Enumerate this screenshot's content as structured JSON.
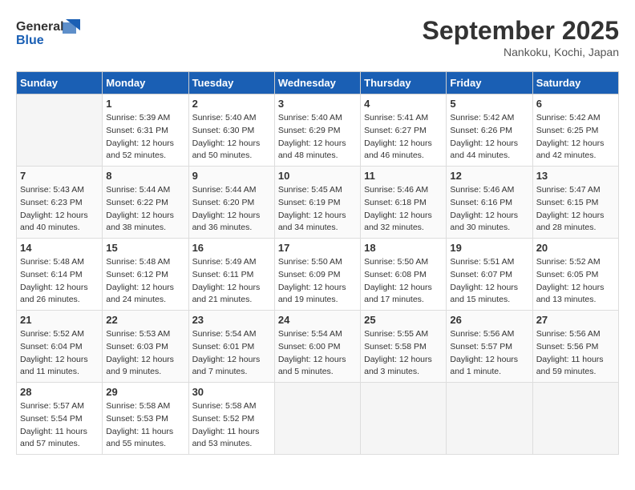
{
  "header": {
    "logo_line1": "General",
    "logo_line2": "Blue",
    "month": "September 2025",
    "location": "Nankoku, Kochi, Japan"
  },
  "weekdays": [
    "Sunday",
    "Monday",
    "Tuesday",
    "Wednesday",
    "Thursday",
    "Friday",
    "Saturday"
  ],
  "weeks": [
    [
      {
        "day": "",
        "info": ""
      },
      {
        "day": "1",
        "info": "Sunrise: 5:39 AM\nSunset: 6:31 PM\nDaylight: 12 hours\nand 52 minutes."
      },
      {
        "day": "2",
        "info": "Sunrise: 5:40 AM\nSunset: 6:30 PM\nDaylight: 12 hours\nand 50 minutes."
      },
      {
        "day": "3",
        "info": "Sunrise: 5:40 AM\nSunset: 6:29 PM\nDaylight: 12 hours\nand 48 minutes."
      },
      {
        "day": "4",
        "info": "Sunrise: 5:41 AM\nSunset: 6:27 PM\nDaylight: 12 hours\nand 46 minutes."
      },
      {
        "day": "5",
        "info": "Sunrise: 5:42 AM\nSunset: 6:26 PM\nDaylight: 12 hours\nand 44 minutes."
      },
      {
        "day": "6",
        "info": "Sunrise: 5:42 AM\nSunset: 6:25 PM\nDaylight: 12 hours\nand 42 minutes."
      }
    ],
    [
      {
        "day": "7",
        "info": "Sunrise: 5:43 AM\nSunset: 6:23 PM\nDaylight: 12 hours\nand 40 minutes."
      },
      {
        "day": "8",
        "info": "Sunrise: 5:44 AM\nSunset: 6:22 PM\nDaylight: 12 hours\nand 38 minutes."
      },
      {
        "day": "9",
        "info": "Sunrise: 5:44 AM\nSunset: 6:20 PM\nDaylight: 12 hours\nand 36 minutes."
      },
      {
        "day": "10",
        "info": "Sunrise: 5:45 AM\nSunset: 6:19 PM\nDaylight: 12 hours\nand 34 minutes."
      },
      {
        "day": "11",
        "info": "Sunrise: 5:46 AM\nSunset: 6:18 PM\nDaylight: 12 hours\nand 32 minutes."
      },
      {
        "day": "12",
        "info": "Sunrise: 5:46 AM\nSunset: 6:16 PM\nDaylight: 12 hours\nand 30 minutes."
      },
      {
        "day": "13",
        "info": "Sunrise: 5:47 AM\nSunset: 6:15 PM\nDaylight: 12 hours\nand 28 minutes."
      }
    ],
    [
      {
        "day": "14",
        "info": "Sunrise: 5:48 AM\nSunset: 6:14 PM\nDaylight: 12 hours\nand 26 minutes."
      },
      {
        "day": "15",
        "info": "Sunrise: 5:48 AM\nSunset: 6:12 PM\nDaylight: 12 hours\nand 24 minutes."
      },
      {
        "day": "16",
        "info": "Sunrise: 5:49 AM\nSunset: 6:11 PM\nDaylight: 12 hours\nand 21 minutes."
      },
      {
        "day": "17",
        "info": "Sunrise: 5:50 AM\nSunset: 6:09 PM\nDaylight: 12 hours\nand 19 minutes."
      },
      {
        "day": "18",
        "info": "Sunrise: 5:50 AM\nSunset: 6:08 PM\nDaylight: 12 hours\nand 17 minutes."
      },
      {
        "day": "19",
        "info": "Sunrise: 5:51 AM\nSunset: 6:07 PM\nDaylight: 12 hours\nand 15 minutes."
      },
      {
        "day": "20",
        "info": "Sunrise: 5:52 AM\nSunset: 6:05 PM\nDaylight: 12 hours\nand 13 minutes."
      }
    ],
    [
      {
        "day": "21",
        "info": "Sunrise: 5:52 AM\nSunset: 6:04 PM\nDaylight: 12 hours\nand 11 minutes."
      },
      {
        "day": "22",
        "info": "Sunrise: 5:53 AM\nSunset: 6:03 PM\nDaylight: 12 hours\nand 9 minutes."
      },
      {
        "day": "23",
        "info": "Sunrise: 5:54 AM\nSunset: 6:01 PM\nDaylight: 12 hours\nand 7 minutes."
      },
      {
        "day": "24",
        "info": "Sunrise: 5:54 AM\nSunset: 6:00 PM\nDaylight: 12 hours\nand 5 minutes."
      },
      {
        "day": "25",
        "info": "Sunrise: 5:55 AM\nSunset: 5:58 PM\nDaylight: 12 hours\nand 3 minutes."
      },
      {
        "day": "26",
        "info": "Sunrise: 5:56 AM\nSunset: 5:57 PM\nDaylight: 12 hours\nand 1 minute."
      },
      {
        "day": "27",
        "info": "Sunrise: 5:56 AM\nSunset: 5:56 PM\nDaylight: 11 hours\nand 59 minutes."
      }
    ],
    [
      {
        "day": "28",
        "info": "Sunrise: 5:57 AM\nSunset: 5:54 PM\nDaylight: 11 hours\nand 57 minutes."
      },
      {
        "day": "29",
        "info": "Sunrise: 5:58 AM\nSunset: 5:53 PM\nDaylight: 11 hours\nand 55 minutes."
      },
      {
        "day": "30",
        "info": "Sunrise: 5:58 AM\nSunset: 5:52 PM\nDaylight: 11 hours\nand 53 minutes."
      },
      {
        "day": "",
        "info": ""
      },
      {
        "day": "",
        "info": ""
      },
      {
        "day": "",
        "info": ""
      },
      {
        "day": "",
        "info": ""
      }
    ]
  ]
}
